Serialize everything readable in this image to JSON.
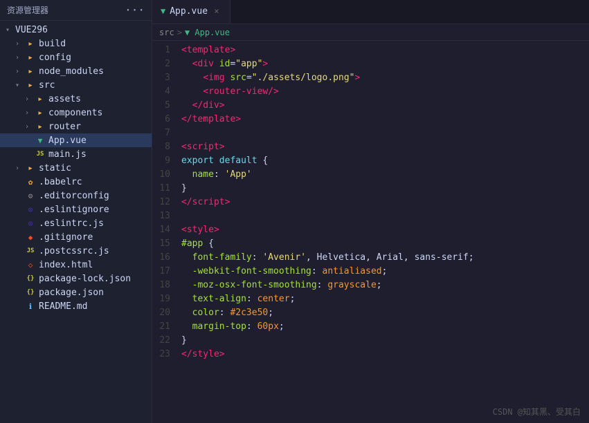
{
  "sidebar": {
    "header": "资源管理器",
    "dots": "···",
    "root": "VUE296",
    "items": [
      {
        "id": "build",
        "label": "build",
        "indent": 1,
        "type": "folder",
        "collapsed": true
      },
      {
        "id": "config",
        "label": "config",
        "indent": 1,
        "type": "folder",
        "collapsed": true
      },
      {
        "id": "node_modules",
        "label": "node_modules",
        "indent": 1,
        "type": "folder",
        "collapsed": true
      },
      {
        "id": "src",
        "label": "src",
        "indent": 1,
        "type": "folder",
        "collapsed": false
      },
      {
        "id": "assets",
        "label": "assets",
        "indent": 2,
        "type": "folder",
        "collapsed": true
      },
      {
        "id": "components",
        "label": "components",
        "indent": 2,
        "type": "folder",
        "collapsed": true
      },
      {
        "id": "router",
        "label": "router",
        "indent": 2,
        "type": "folder",
        "collapsed": true
      },
      {
        "id": "App.vue",
        "label": "App.vue",
        "indent": 2,
        "type": "vue",
        "active": true
      },
      {
        "id": "main.js",
        "label": "main.js",
        "indent": 2,
        "type": "js"
      },
      {
        "id": "static",
        "label": "static",
        "indent": 1,
        "type": "folder",
        "collapsed": true
      },
      {
        "id": ".babelrc",
        "label": ".babelrc",
        "indent": 1,
        "type": "babel"
      },
      {
        "id": ".editorconfig",
        "label": ".editorconfig",
        "indent": 1,
        "type": "editor"
      },
      {
        "id": ".eslintignore",
        "label": ".eslintignore",
        "indent": 1,
        "type": "eslint"
      },
      {
        "id": ".eslintrc.js",
        "label": ".eslintrc.js",
        "indent": 1,
        "type": "eslintjs"
      },
      {
        "id": ".gitignore",
        "label": ".gitignore",
        "indent": 1,
        "type": "git"
      },
      {
        "id": ".postcssrc.js",
        "label": ".postcssrc.js",
        "indent": 1,
        "type": "postcss"
      },
      {
        "id": "index.html",
        "label": "index.html",
        "indent": 1,
        "type": "html"
      },
      {
        "id": "package-lock.json",
        "label": "package-lock.json",
        "indent": 1,
        "type": "json"
      },
      {
        "id": "package.json",
        "label": "package.json",
        "indent": 1,
        "type": "json"
      },
      {
        "id": "README.md",
        "label": "README.md",
        "indent": 1,
        "type": "md"
      }
    ]
  },
  "tab": {
    "filename": "App.vue",
    "close": "×"
  },
  "breadcrumb": {
    "src": "src",
    "sep1": ">",
    "file": "App.vue"
  },
  "lines": [
    {
      "num": 1,
      "html": "<span class='c-tag'>&lt;template&gt;</span>"
    },
    {
      "num": 2,
      "html": "  <span class='c-tag'>&lt;div</span> <span class='c-attr-name'>id</span><span class='c-punct'>=</span><span class='c-attr-val'>\"app\"</span><span class='c-tag'>&gt;</span>"
    },
    {
      "num": 3,
      "html": "    <span class='c-tag'>&lt;img</span> <span class='c-attr-name'>src</span><span class='c-punct'>=</span><span class='c-attr-val'>\"./assets/logo.png\"</span><span class='c-tag'>&gt;</span>"
    },
    {
      "num": 4,
      "html": "    <span class='c-tag'>&lt;router-view/&gt;</span>"
    },
    {
      "num": 5,
      "html": "  <span class='c-tag'>&lt;/div&gt;</span>"
    },
    {
      "num": 6,
      "html": "<span class='c-tag'>&lt;/template&gt;</span>"
    },
    {
      "num": 7,
      "html": ""
    },
    {
      "num": 8,
      "html": "<span class='c-tag'>&lt;script&gt;</span>"
    },
    {
      "num": 9,
      "html": "<span class='c-keyword'>export default</span> <span class='c-punct'>{</span>"
    },
    {
      "num": 10,
      "html": "  <span class='c-prop'>name</span><span class='c-punct'>:</span> <span class='c-string'>'App'</span>"
    },
    {
      "num": 11,
      "html": "<span class='c-punct'>}</span>"
    },
    {
      "num": 12,
      "html": "<span class='c-tag'>&lt;/script&gt;</span>"
    },
    {
      "num": 13,
      "html": ""
    },
    {
      "num": 14,
      "html": "<span class='c-tag'>&lt;style&gt;</span>"
    },
    {
      "num": 15,
      "html": "<span class='c-selector'>#app</span> <span class='c-punct'>{</span>"
    },
    {
      "num": 16,
      "html": "  <span class='c-prop'>font-family</span><span class='c-punct'>:</span> <span class='c-string'>'Avenir'</span><span class='c-text'>, Helvetica, Arial, sans-serif;</span>"
    },
    {
      "num": 17,
      "html": "  <span class='c-prop'>-webkit-font-smoothing</span><span class='c-punct'>:</span> <span class='c-value'>antialiased</span><span class='c-text'>;</span>"
    },
    {
      "num": 18,
      "html": "  <span class='c-prop'>-moz-osx-font-smoothing</span><span class='c-punct'>:</span> <span class='c-value'>grayscale</span><span class='c-text'>;</span>"
    },
    {
      "num": 19,
      "html": "  <span class='c-prop'>text-align</span><span class='c-punct'>:</span> <span class='c-value'>center</span><span class='c-text'>;</span>"
    },
    {
      "num": 20,
      "html": "  <span class='c-prop'>color</span><span class='c-punct'>:</span> <span class='c-value'>#2c3e50</span><span class='c-text'>;</span>"
    },
    {
      "num": 21,
      "html": "  <span class='c-prop'>margin-top</span><span class='c-punct'>:</span> <span class='c-value'>60px</span><span class='c-text'>;</span>"
    },
    {
      "num": 22,
      "html": "<span class='c-punct'>}</span>"
    },
    {
      "num": 23,
      "html": "<span class='c-tag'>&lt;/style&gt;</span>"
    }
  ],
  "watermark": "CSDN @知其黑、受其白"
}
